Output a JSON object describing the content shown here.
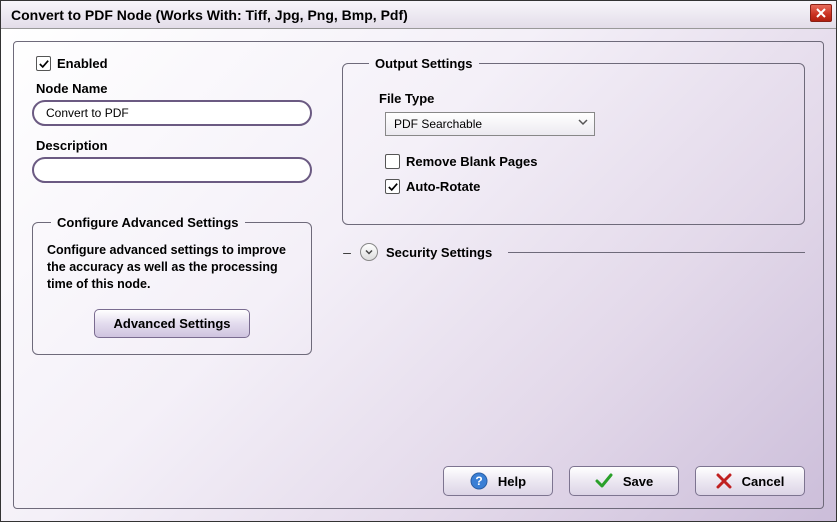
{
  "titlebar": {
    "title": "Convert to PDF Node    (Works With: Tiff, Jpg, Png, Bmp, Pdf)"
  },
  "left": {
    "enabled_label": "Enabled",
    "enabled_checked": true,
    "node_name_label": "Node Name",
    "node_name_value": "Convert to PDF",
    "description_label": "Description",
    "description_value": ""
  },
  "advanced_group": {
    "legend": "Configure Advanced Settings",
    "desc": "Configure advanced settings to improve the accuracy as well as the processing time of this node.",
    "button_label": "Advanced Settings"
  },
  "output_group": {
    "legend": "Output Settings",
    "file_type_label": "File Type",
    "file_type_value": "PDF Searchable",
    "remove_blank_label": "Remove Blank Pages",
    "remove_blank_checked": false,
    "auto_rotate_label": "Auto-Rotate",
    "auto_rotate_checked": true
  },
  "security": {
    "label": "Security Settings",
    "expanded": false
  },
  "footer": {
    "help": "Help",
    "save": "Save",
    "cancel": "Cancel"
  }
}
